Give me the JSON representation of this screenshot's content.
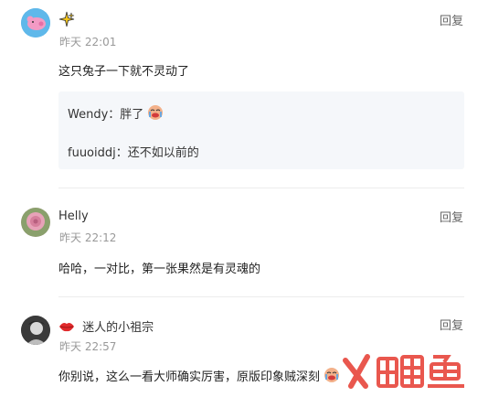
{
  "comments": [
    {
      "name": "",
      "time": "昨天 22:01",
      "reply_label": "回复",
      "text": "这只兔子一下就不灵动了",
      "replies": [
        {
          "user": "Wendy",
          "text": "：胖了"
        },
        {
          "user": "fuuoiddj",
          "text": "：还不如以前的"
        }
      ]
    },
    {
      "name": "Helly",
      "time": "昨天 22:12",
      "reply_label": "回复",
      "text": "哈哈，一对比，第一张果然是有灵魂的"
    },
    {
      "name": "迷人的小祖宗",
      "time": "昨天 22:57",
      "reply_label": "回复",
      "text": "你别说，这么一看大师确实厉害，原版印象贼深刻"
    }
  ],
  "icons": {
    "sparkle": "sparkle-icon",
    "crying_face": "crying-face-emoji",
    "lips": "lips-icon"
  },
  "colors": {
    "watermark": "#e8493f",
    "reply_bg": "#f5f7fa",
    "muted": "#999999"
  }
}
